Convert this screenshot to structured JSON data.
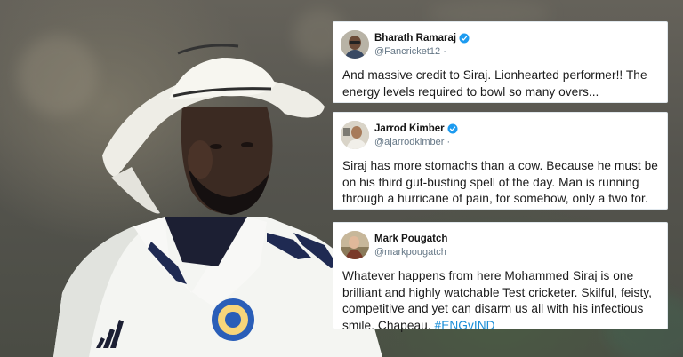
{
  "tweets": [
    {
      "display_name": "Bharath Ramaraj",
      "handle": "@Fancricket12 ·",
      "verified": true,
      "text": "And massive credit to Siraj. Lionhearted performer!! The energy levels required to bowl so many overs..."
    },
    {
      "display_name": "Jarrod Kimber",
      "handle": "@ajarrodkimber ·",
      "verified": true,
      "text": "Siraj has more stomachs than a cow. Because he must be on his third gut-busting spell of the day. Man is running through a hurricane of pain, for somehow, only a two for."
    },
    {
      "display_name": "Mark Pougatch",
      "handle": "@markpougatch",
      "verified": false,
      "text": "Whatever happens from here Mohammed Siraj is one brilliant  and highly watchable Test cricketer. Skilful, feisty, competitive and yet can disarm us all with his infectious smile. Chapeau.",
      "hashtag": "#ENGvIND"
    }
  ],
  "colors": {
    "verified_badge": "#1d9bf0",
    "hashtag": "#1b8fd8",
    "handle": "#657786"
  },
  "icons": {
    "verified": "verified-badge-icon",
    "jersey_logo": "adidas-logo",
    "jersey_crest": "bcci-crest"
  }
}
